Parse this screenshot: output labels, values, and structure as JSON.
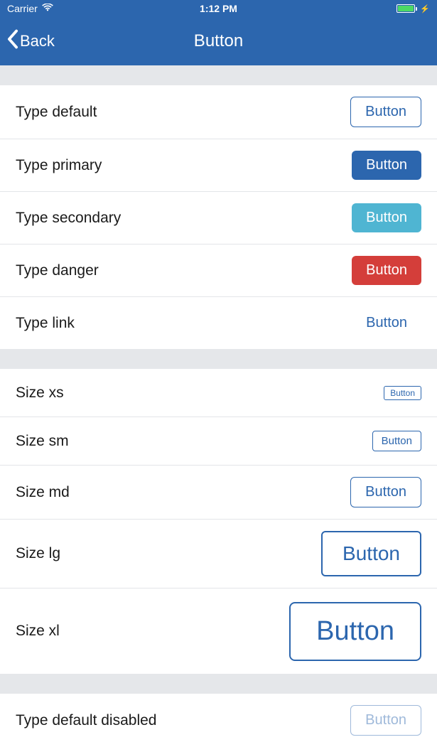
{
  "status": {
    "carrier": "Carrier",
    "time": "1:12 PM"
  },
  "nav": {
    "back_label": "Back",
    "title": "Button"
  },
  "sections": {
    "types": [
      {
        "label": "Type default",
        "button_text": "Button",
        "variant": "default"
      },
      {
        "label": "Type primary",
        "button_text": "Button",
        "variant": "primary"
      },
      {
        "label": "Type secondary",
        "button_text": "Button",
        "variant": "secondary"
      },
      {
        "label": "Type danger",
        "button_text": "Button",
        "variant": "danger"
      },
      {
        "label": "Type link",
        "button_text": "Button",
        "variant": "link"
      }
    ],
    "sizes": [
      {
        "label": "Size xs",
        "button_text": "Button",
        "size": "xs"
      },
      {
        "label": "Size sm",
        "button_text": "Button",
        "size": "sm"
      },
      {
        "label": "Size md",
        "button_text": "Button",
        "size": "md"
      },
      {
        "label": "Size lg",
        "button_text": "Button",
        "size": "lg"
      },
      {
        "label": "Size xl",
        "button_text": "Button",
        "size": "xl"
      }
    ],
    "disabled": [
      {
        "label": "Type default disabled",
        "button_text": "Button",
        "variant": "default"
      }
    ]
  },
  "colors": {
    "primary": "#2c66ae",
    "secondary": "#4fb5d2",
    "danger": "#d43e3a"
  }
}
